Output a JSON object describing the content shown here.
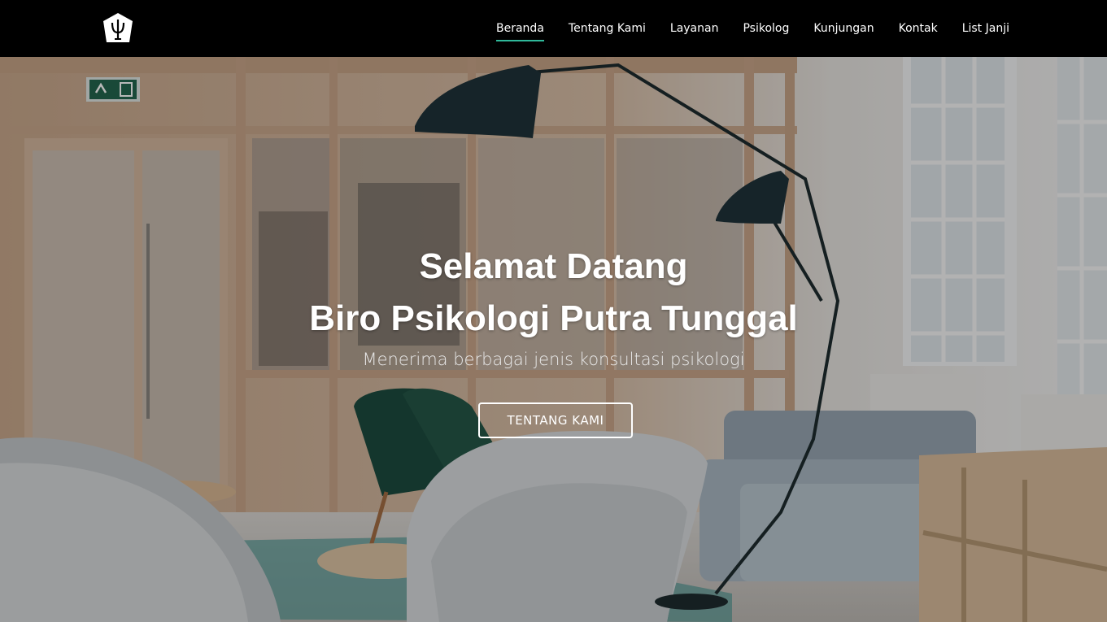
{
  "nav": {
    "logo_icon": "trident-shield-logo",
    "items": [
      {
        "label": "Beranda",
        "active": true
      },
      {
        "label": "Tentang Kami",
        "active": false
      },
      {
        "label": "Layanan",
        "active": false
      },
      {
        "label": "Psikolog",
        "active": false
      },
      {
        "label": "Kunjungan",
        "active": false
      },
      {
        "label": "Kontak",
        "active": false
      },
      {
        "label": "List Janji",
        "active": false
      }
    ],
    "active_underline_color": "#2fb99a"
  },
  "hero": {
    "title_line1": "Selamat Datang",
    "title_line2": "Biro Psikologi Putra Tunggal",
    "subtitle": "Menerima berbagai jenis konsultasi psikologi",
    "button_label": "TENTANG KAMI",
    "background": "office-lounge-photo",
    "exit_sign_icon": "exit-sign-icon"
  }
}
